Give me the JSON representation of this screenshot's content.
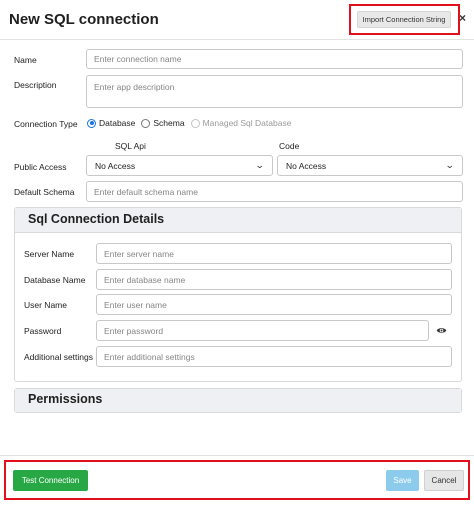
{
  "dialog": {
    "title": "New SQL connection",
    "import_label": "Import Connection String",
    "close_glyph": "×"
  },
  "form": {
    "name_label": "Name",
    "name_placeholder": "Enter connection name",
    "description_label": "Description",
    "description_placeholder": "Enter app description",
    "connection_type_label": "Connection Type",
    "connection_type_options": [
      "Database",
      "Schema",
      "Managed Sql Database"
    ],
    "connection_type_selected": "Database",
    "public_access_label": "Public Access",
    "sql_api_label": "SQL Api",
    "sql_api_value": "No Access",
    "code_label": "Code",
    "code_value": "No Access",
    "default_schema_label": "Default Schema",
    "default_schema_placeholder": "Enter default schema name"
  },
  "sql_details": {
    "title": "Sql Connection Details",
    "server_label": "Server Name",
    "server_placeholder": "Enter server name",
    "database_label": "Database Name",
    "database_placeholder": "Enter database name",
    "user_label": "User Name",
    "user_placeholder": "Enter user name",
    "password_label": "Password",
    "password_placeholder": "Enter password",
    "additional_label": "Additional settings",
    "additional_placeholder": "Enter additional settings"
  },
  "permissions": {
    "title": "Permissions"
  },
  "footer": {
    "test_label": "Test Connection",
    "save_label": "Save",
    "cancel_label": "Cancel"
  },
  "colors": {
    "highlight": "#e3101c",
    "test_button": "#28a745",
    "save_button": "#8ccbeb",
    "radio_accent": "#1a73e8"
  },
  "icons": {
    "close": "close-icon",
    "eye": "eye-icon",
    "select_chevron": "chevron-down-icon"
  }
}
